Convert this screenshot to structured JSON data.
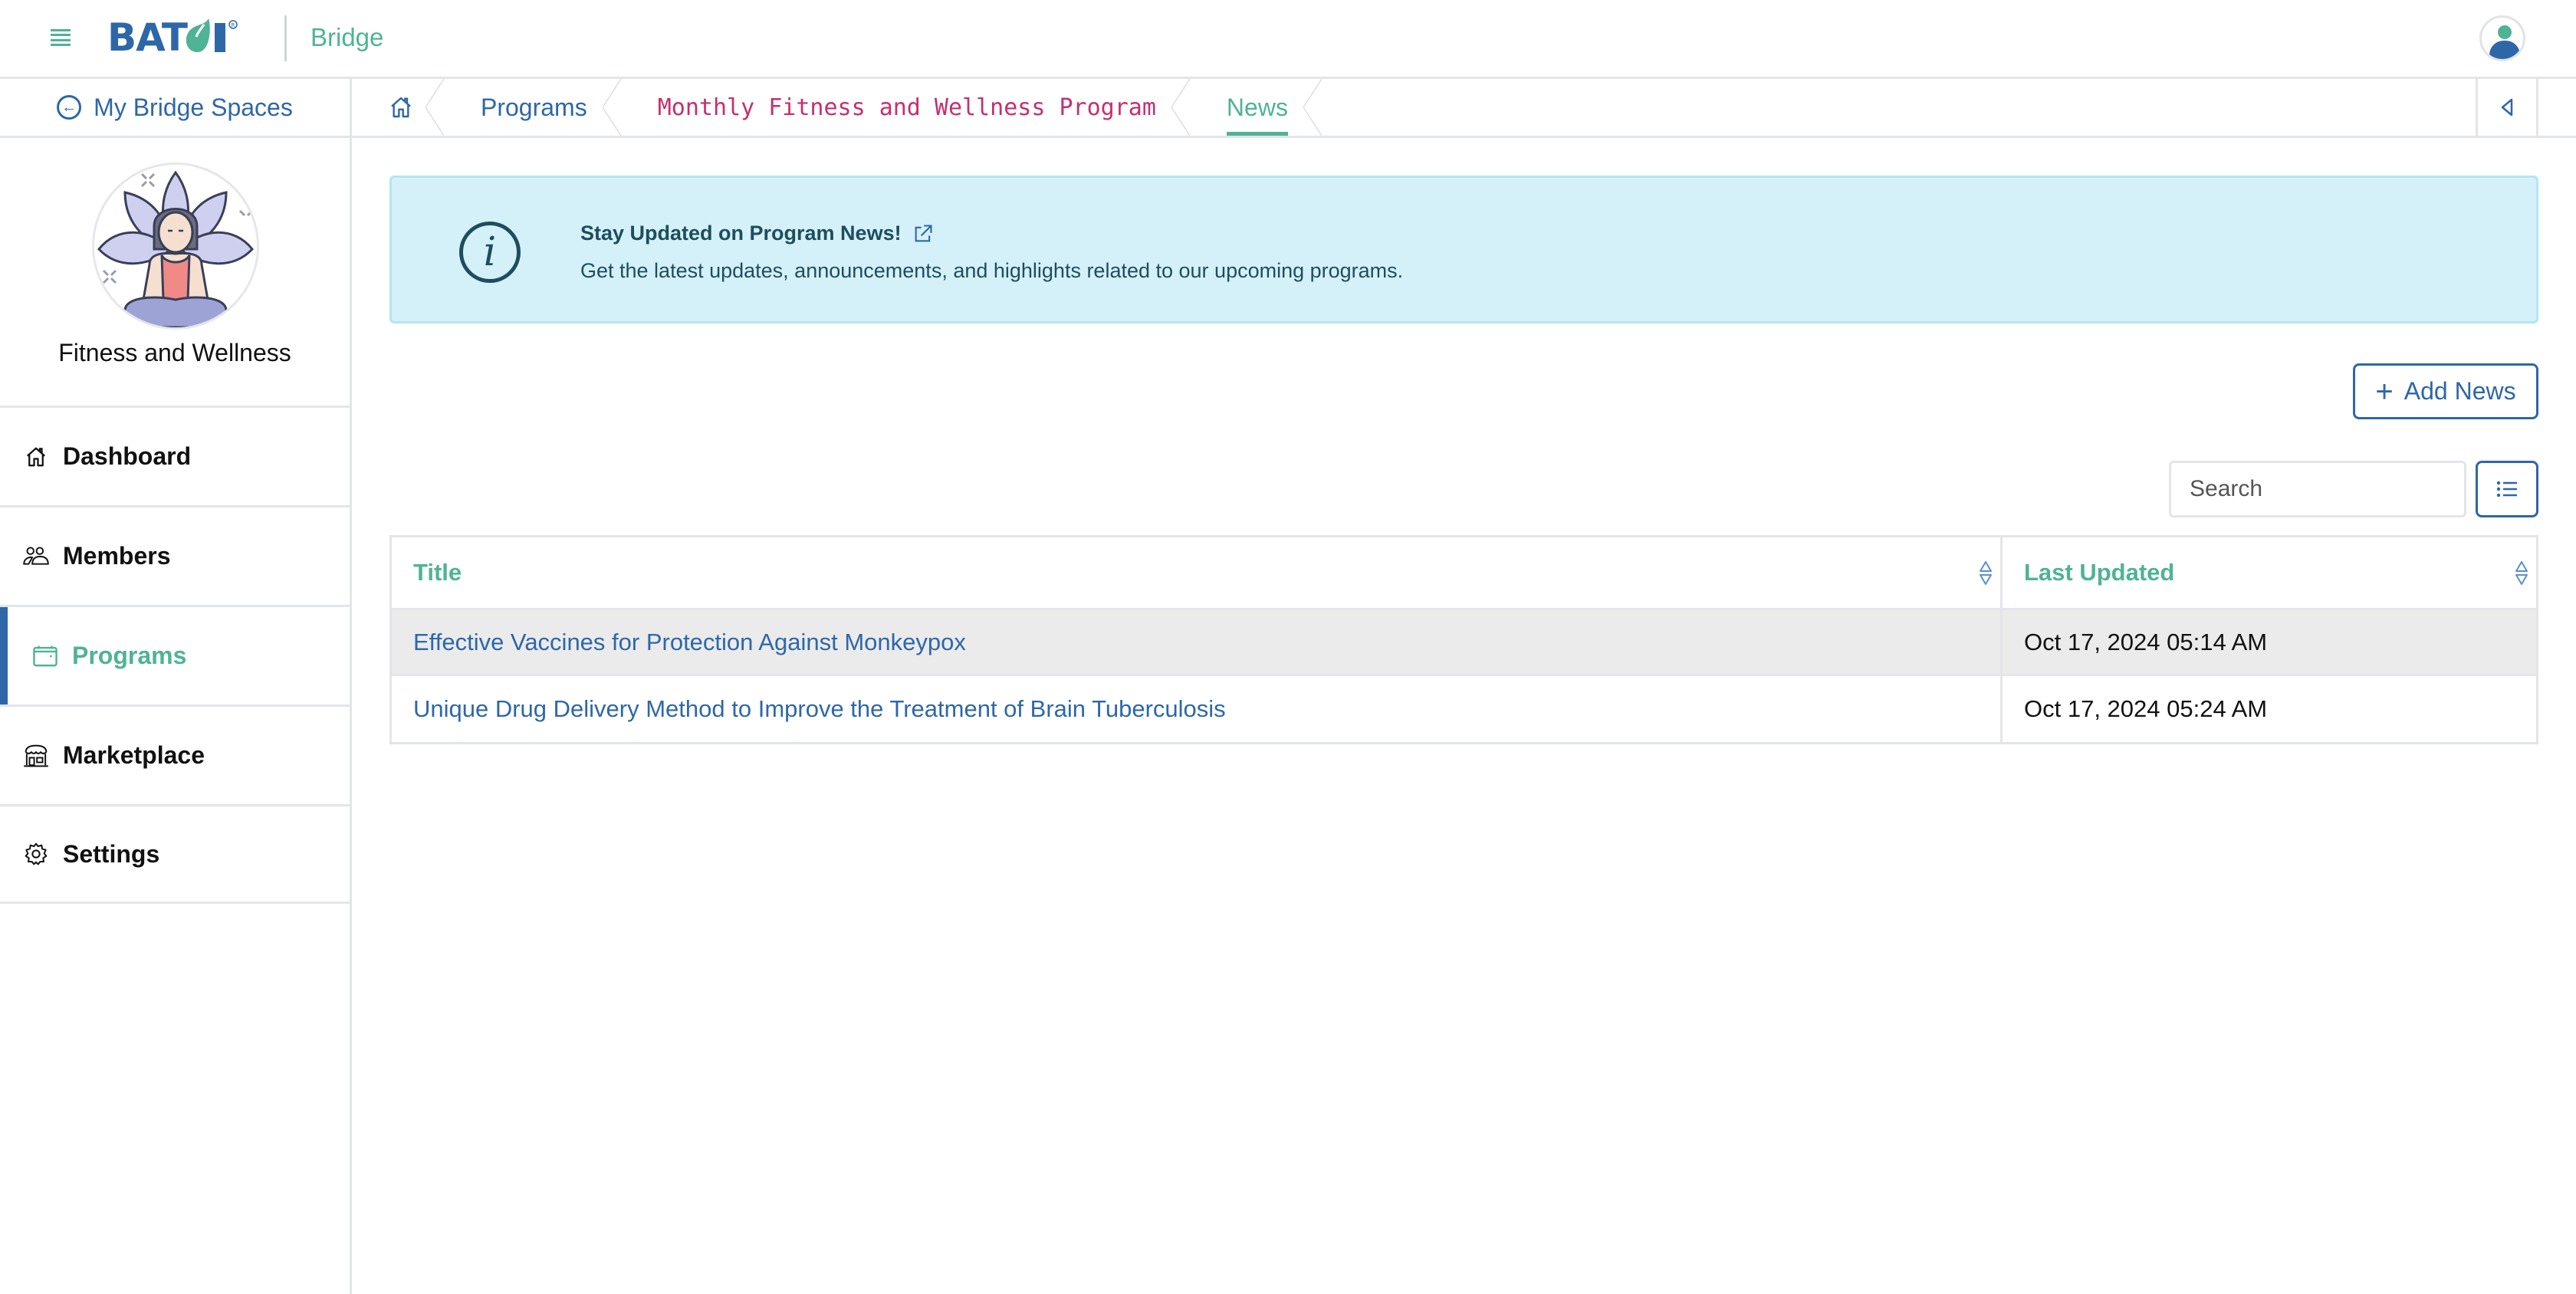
{
  "header": {
    "logo_text": "BATOI",
    "logo_reg": "®",
    "app_name": "Bridge",
    "colors": {
      "brand_blue": "#2e67a8",
      "brand_green": "#4fb395",
      "breadcrumb_program": "#c4306e"
    }
  },
  "breadcrumb": {
    "back_label": "My Bridge Spaces",
    "items": [
      {
        "label": "",
        "icon": "home-icon"
      },
      {
        "label": "Programs"
      },
      {
        "label": "Monthly Fitness and Wellness Program"
      },
      {
        "label": "News",
        "active": true
      }
    ]
  },
  "sidebar": {
    "space_name": "Fitness and Wellness",
    "items": [
      {
        "label": "Dashboard",
        "icon": "home-icon"
      },
      {
        "label": "Members",
        "icon": "members-icon"
      },
      {
        "label": "Programs",
        "icon": "calendar-icon",
        "active": true
      },
      {
        "label": "Marketplace",
        "icon": "store-icon"
      },
      {
        "label": "Settings",
        "icon": "gear-icon"
      }
    ]
  },
  "banner": {
    "title": "Stay Updated on Program News!",
    "text": "Get the latest updates, announcements, and highlights related to our upcoming programs."
  },
  "toolbar": {
    "add_label": "Add News",
    "search_placeholder": "Search",
    "search_value": ""
  },
  "table": {
    "columns": [
      "Title",
      "Last Updated"
    ],
    "rows": [
      {
        "title": "Effective Vaccines for Protection Against Monkeypox",
        "updated": "Oct 17, 2024 05:14 AM"
      },
      {
        "title": "Unique Drug Delivery Method to Improve the Treatment of Brain Tuberculosis",
        "updated": "Oct 17, 2024 05:24 AM"
      }
    ]
  }
}
